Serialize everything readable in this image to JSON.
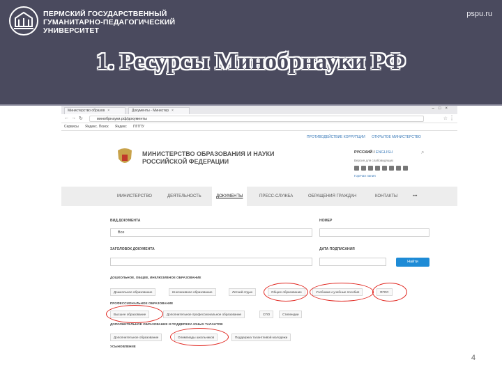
{
  "header": {
    "university_name": [
      "ПЕРМСКИЙ ГОСУДАРСТВЕННЫЙ",
      "ГУМАНИТАРНО-ПЕДАГОГИЧЕСКИЙ",
      "УНИВЕРСИТЕТ"
    ],
    "site_url": "pspu.ru",
    "slide_title": "1. Ресурсы Минобрнауки РФ",
    "bg_color": "#4a4a5e",
    "page_number": "4"
  },
  "browser": {
    "tabs": [
      "Министерство образов",
      "Документы - Министер"
    ],
    "url": "минобрнауки.рф/документы",
    "bookmarks": [
      "Сервисы",
      "Яндекс. Поиск",
      "Яндекс",
      "ПГГПУ"
    ]
  },
  "site": {
    "top_links": [
      "ПРОТИВОДЕЙСТВИЕ КОРРУПЦИИ",
      "ОТКРЫТОЕ МИНИСТЕРСТВО"
    ],
    "ministry_name": [
      "МИНИСТЕРСТВО ОБРАЗОВАНИЯ И НАУКИ",
      "РОССИЙСКОЙ ФЕДЕРАЦИИ"
    ],
    "lang_active": "РУССКИЙ",
    "lang_alt": "ENGLISH",
    "sub_line": "Версия для слабовидящих",
    "phone": "Горячая линия",
    "nav": [
      "МИНИСТЕРСТВО",
      "ДЕЯТЕЛЬНОСТЬ",
      "ДОКУМЕНТЫ",
      "ПРЕСС-СЛУЖБА",
      "ОБРАЩЕНИЯ ГРАЖДАН",
      "КОНТАКТЫ",
      "•••"
    ]
  },
  "form": {
    "doc_type_label": "ВИД ДОКУМЕНТА",
    "doc_type_value": "Все",
    "number_label": "НОМЕР",
    "title_label": "ЗАГОЛОВОК ДОКУМЕНТА",
    "date_label": "ДАТА ПОДПИСАНИЯ",
    "find_label": "Найти",
    "section1": "ДОШКОЛЬНОЕ, ОБЩЕЕ, ИНКЛЮЗИВНОЕ ОБРАЗОВАНИЕ",
    "chips1": [
      "Дошкольное образование",
      "Инклюзивное образование",
      "Летний отдых",
      "Общее образование",
      "Учебники и учебные пособия",
      "ФГОС"
    ],
    "section2": "ПРОФЕССИОНАЛЬНОЕ ОБРАЗОВАНИЕ",
    "chips2": [
      "Высшее образование",
      "Дополнительное профессиональное образование",
      "СПО",
      "Стипендии"
    ],
    "section3": "ДОПОЛНИТЕЛЬНОЕ ОБРАЗОВАНИЕ И ПОДДЕРЖКА ЮНЫХ ТАЛАНТОВ",
    "chips3": [
      "Дополнительное образование",
      "Олимпиады школьников",
      "Поддержка талантливой молодежи"
    ],
    "section4": "УСЫНОВЛЕНИЕ"
  },
  "highlight_color": "#e0231c"
}
